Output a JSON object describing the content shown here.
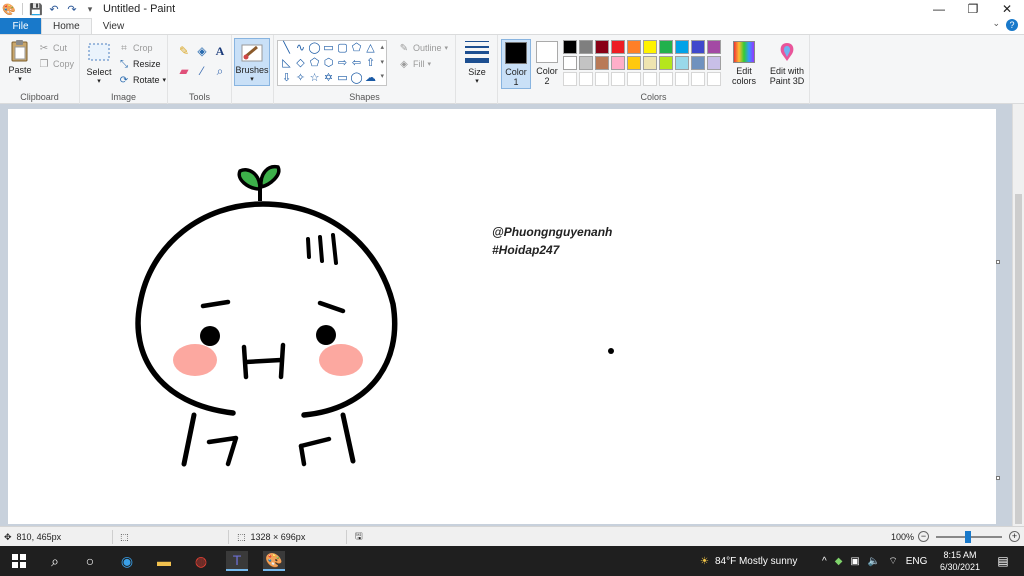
{
  "window": {
    "title": "Untitled - Paint",
    "controls": [
      "—",
      "❐",
      "✕"
    ]
  },
  "tabs": {
    "file": "File",
    "home": "Home",
    "view": "View"
  },
  "ribbon": {
    "clipboard": {
      "label": "Clipboard",
      "paste": "Paste",
      "cut": "Cut",
      "copy": "Copy"
    },
    "image": {
      "label": "Image",
      "select": "Select",
      "crop": "Crop",
      "resize": "Resize",
      "rotate": "Rotate"
    },
    "tools": {
      "label": "Tools"
    },
    "brushes": {
      "label": "Brushes"
    },
    "shapes": {
      "label": "Shapes",
      "outline": "Outline",
      "fill": "Fill"
    },
    "size": {
      "label": "Size"
    },
    "colors": {
      "label": "Colors",
      "color1_line1": "Color",
      "color1_line2": "1",
      "color2_line1": "Color",
      "color2_line2": "2",
      "edit_line1": "Edit",
      "edit_line2": "colors",
      "paint3d_line1": "Edit with",
      "paint3d_line2": "Paint 3D",
      "color1_value": "#000000",
      "color2_value": "#ffffff",
      "palette_row1": [
        "#000000",
        "#7f7f7f",
        "#880015",
        "#ed1c24",
        "#ff7f27",
        "#fff200",
        "#22b14c",
        "#00a2e8",
        "#3f48cc",
        "#a349a4"
      ],
      "palette_row2": [
        "#ffffff",
        "#c3c3c3",
        "#b97a57",
        "#ffaec9",
        "#ffc90e",
        "#efe4b0",
        "#b5e61d",
        "#99d9ea",
        "#7092be",
        "#c8bfe7"
      ]
    }
  },
  "canvas": {
    "text_line1": "@Phuongnguyenanh",
    "text_line2": "#Hoidap247"
  },
  "status": {
    "cursor_pos": "810, 465px",
    "canvas_size": "1328 × 696px",
    "zoom": "100%"
  },
  "taskbar": {
    "weather": "84°F  Mostly sunny",
    "lang": "ENG",
    "time": "8:15 AM",
    "date": "6/30/2021"
  }
}
